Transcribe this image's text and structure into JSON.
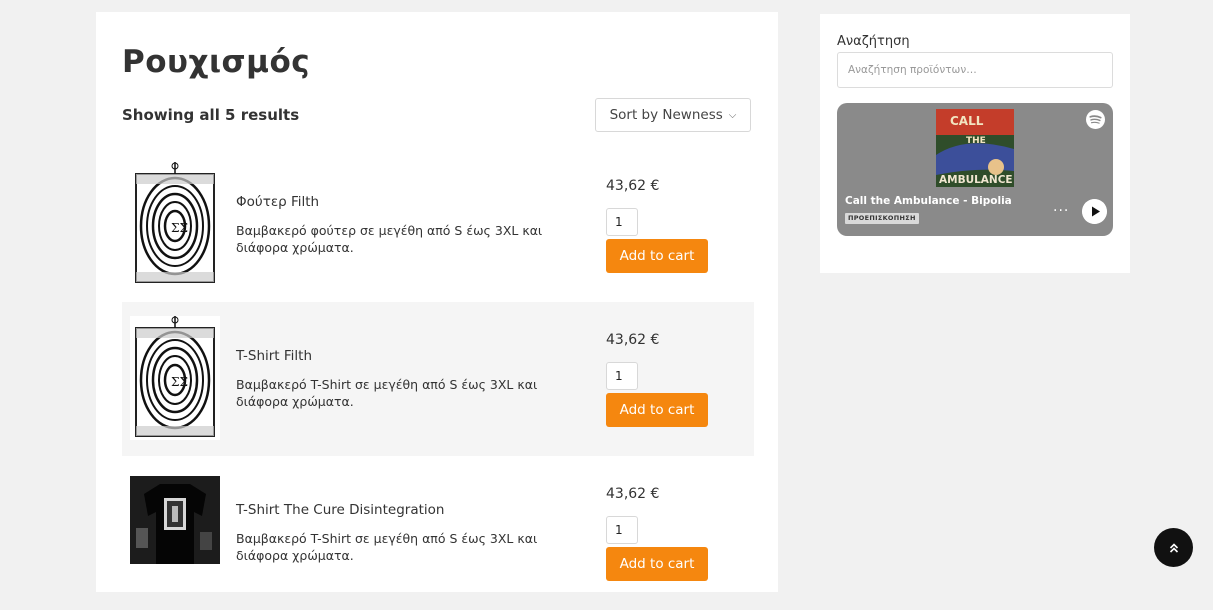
{
  "page": {
    "title": "Ρουχισμός",
    "results_text": "Showing all 5 results",
    "sort_label": "Sort by Newness",
    "sort_icon": "chevron-down-icon"
  },
  "products": [
    {
      "name": "Φούτερ Filth",
      "description": "Βαμβακερό φούτερ σε μεγέθη από S έως 3XL και διάφορα χρώματα.",
      "price": "43,62 €",
      "quantity": "1",
      "cart_label": "Add to cart"
    },
    {
      "name": "T-Shirt Filth",
      "description": "Βαμβακερό T-Shirt σε μεγέθη από S έως 3XL και διάφορα χρώματα.",
      "price": "43,62 €",
      "quantity": "1",
      "cart_label": "Add to cart"
    },
    {
      "name": "T-Shirt The Cure Disintegration",
      "description": "Βαμβακερό T-Shirt σε μεγέθη από S έως 3XL και διάφορα χρώματα.",
      "price": "43,62 €",
      "quantity": "1",
      "cart_label": "Add to cart"
    }
  ],
  "sidebar": {
    "search_title": "Αναζήτηση",
    "search_placeholder": "Αναζήτηση προϊόντων…",
    "player": {
      "track": "Call the Ambulance - Bipolia",
      "badge": "ΠΡΟΕΠΙΣΚΟΠΗΣΗ",
      "more": "···",
      "cover_text_top": "CALL",
      "cover_text_mid": "THE",
      "cover_text_bottom": "AMBULANCE",
      "logo_icon": "spotify-icon",
      "play_icon": "play-icon"
    }
  },
  "colors": {
    "accent": "#f5870f",
    "background": "#f1f1f1",
    "player_bg": "#8a8a8a"
  },
  "scroll_top_icon": "chevrons-up-icon"
}
